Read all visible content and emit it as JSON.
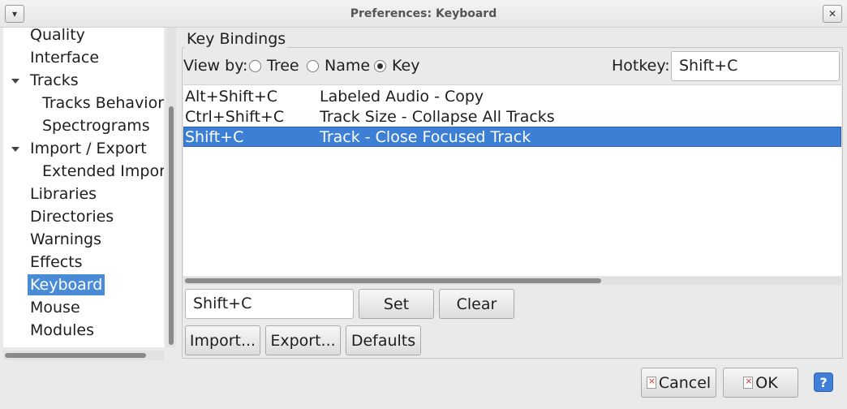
{
  "window": {
    "title": "Preferences: Keyboard"
  },
  "sidebar": {
    "items": [
      {
        "label": "Quality"
      },
      {
        "label": "Interface"
      },
      {
        "label": "Tracks"
      },
      {
        "label": "Tracks Behaviors"
      },
      {
        "label": "Spectrograms"
      },
      {
        "label": "Import / Export"
      },
      {
        "label": "Extended Import"
      },
      {
        "label": "Libraries"
      },
      {
        "label": "Directories"
      },
      {
        "label": "Warnings"
      },
      {
        "label": "Effects"
      },
      {
        "label": "Keyboard"
      },
      {
        "label": "Mouse"
      },
      {
        "label": "Modules"
      }
    ],
    "selected": "Keyboard"
  },
  "key_bindings": {
    "group_label": "Key Bindings",
    "view_by_label": "View by:",
    "view_options": [
      "Tree",
      "Name",
      "Key"
    ],
    "view_selected": "Key",
    "hotkey_label": "Hotkey:",
    "hotkey_value": "Shift+C",
    "rows": [
      {
        "key": "Alt+Shift+C",
        "command": "Labeled Audio - Copy"
      },
      {
        "key": "Ctrl+Shift+C",
        "command": "Track Size - Collapse All Tracks"
      },
      {
        "key": "Shift+C",
        "command": "Track - Close Focused Track"
      }
    ],
    "selected_row": "Shift+C",
    "key_field_value": "Shift+C",
    "set_label": "Set",
    "clear_label": "Clear",
    "import_label": "Import...",
    "export_label": "Export...",
    "defaults_label": "Defaults"
  },
  "footer": {
    "cancel_label": "Cancel",
    "ok_label": "OK",
    "help_label": "?"
  },
  "colors": {
    "selection": "#3d7fd4",
    "sidebar_selection": "#4a8bd8",
    "help_button": "#3f7fd9"
  },
  "icons": {
    "window_menu": "chevron-down-icon",
    "close": "close-icon",
    "tree_expand": "triangle-down-icon",
    "button_icon": "document-icon",
    "help": "question-icon"
  }
}
